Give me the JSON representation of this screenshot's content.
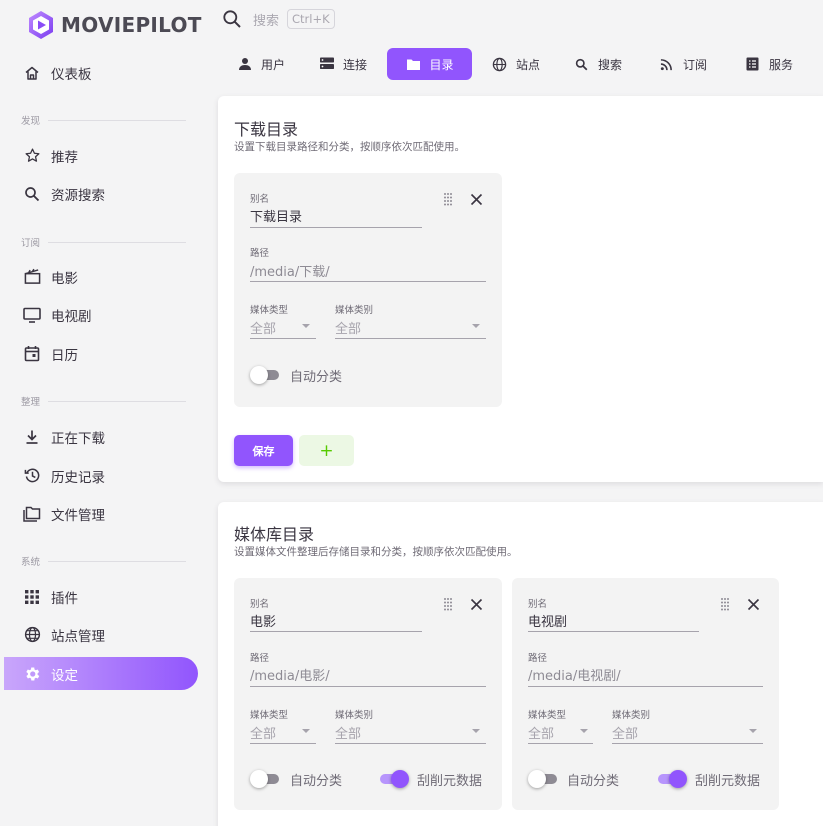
{
  "app": {
    "name": "MOVIEPILOT"
  },
  "colors": {
    "primary": "#9155fd",
    "success": "#56ca00",
    "text": "#3a3541"
  },
  "search": {
    "placeholder": "搜索",
    "shortcut": "Ctrl+K"
  },
  "sidebar": {
    "dashboard": {
      "label": "仪表板",
      "icon": "home-icon"
    },
    "sections": [
      {
        "title": "发现",
        "items": [
          {
            "label": "推荐",
            "icon": "star-icon"
          },
          {
            "label": "资源搜索",
            "icon": "search-icon"
          }
        ]
      },
      {
        "title": "订阅",
        "items": [
          {
            "label": "电影",
            "icon": "movie-icon"
          },
          {
            "label": "电视剧",
            "icon": "tv-icon"
          },
          {
            "label": "日历",
            "icon": "calendar-icon"
          }
        ]
      },
      {
        "title": "整理",
        "items": [
          {
            "label": "正在下载",
            "icon": "download-icon"
          },
          {
            "label": "历史记录",
            "icon": "history-icon"
          },
          {
            "label": "文件管理",
            "icon": "folder-icon"
          }
        ]
      },
      {
        "title": "系统",
        "items": [
          {
            "label": "插件",
            "icon": "apps-icon"
          },
          {
            "label": "站点管理",
            "icon": "globe-icon"
          },
          {
            "label": "设定",
            "icon": "gear-icon",
            "active": true
          }
        ]
      }
    ]
  },
  "tabs": [
    {
      "label": "用户",
      "icon": "user-icon"
    },
    {
      "label": "连接",
      "icon": "server-icon"
    },
    {
      "label": "目录",
      "icon": "folder-icon",
      "active": true
    },
    {
      "label": "站点",
      "icon": "globe-icon"
    },
    {
      "label": "搜索",
      "icon": "search-icon"
    },
    {
      "label": "订阅",
      "icon": "rss-icon"
    },
    {
      "label": "服务",
      "icon": "list-icon"
    }
  ],
  "download_section": {
    "title": "下载目录",
    "subtitle": "设置下载目录路径和分类，按顺序依次匹配使用。",
    "cards": [
      {
        "alias_label": "别名",
        "alias": "下载目录",
        "path_label": "路径",
        "path": "/media/下载/",
        "media_type_label": "媒体类型",
        "media_type": "全部",
        "media_category_label": "媒体类别",
        "media_category": "全部",
        "auto_category_label": "自动分类",
        "auto_category": false
      }
    ],
    "save_label": "保存",
    "add_label": "+"
  },
  "library_section": {
    "title": "媒体库目录",
    "subtitle": "设置媒体文件整理后存储目录和分类，按顺序依次匹配使用。",
    "cards": [
      {
        "alias_label": "别名",
        "alias": "电影",
        "path_label": "路径",
        "path": "/media/电影/",
        "media_type_label": "媒体类型",
        "media_type": "全部",
        "media_category_label": "媒体类别",
        "media_category": "全部",
        "auto_category_label": "自动分类",
        "auto_category": false,
        "scrape_label": "刮削元数据",
        "scrape": true
      },
      {
        "alias_label": "别名",
        "alias": "电视剧",
        "path_label": "路径",
        "path": "/media/电视剧/",
        "media_type_label": "媒体类型",
        "media_type": "全部",
        "media_category_label": "媒体类别",
        "media_category": "全部",
        "auto_category_label": "自动分类",
        "auto_category": false,
        "scrape_label": "刮削元数据",
        "scrape": true
      }
    ]
  }
}
